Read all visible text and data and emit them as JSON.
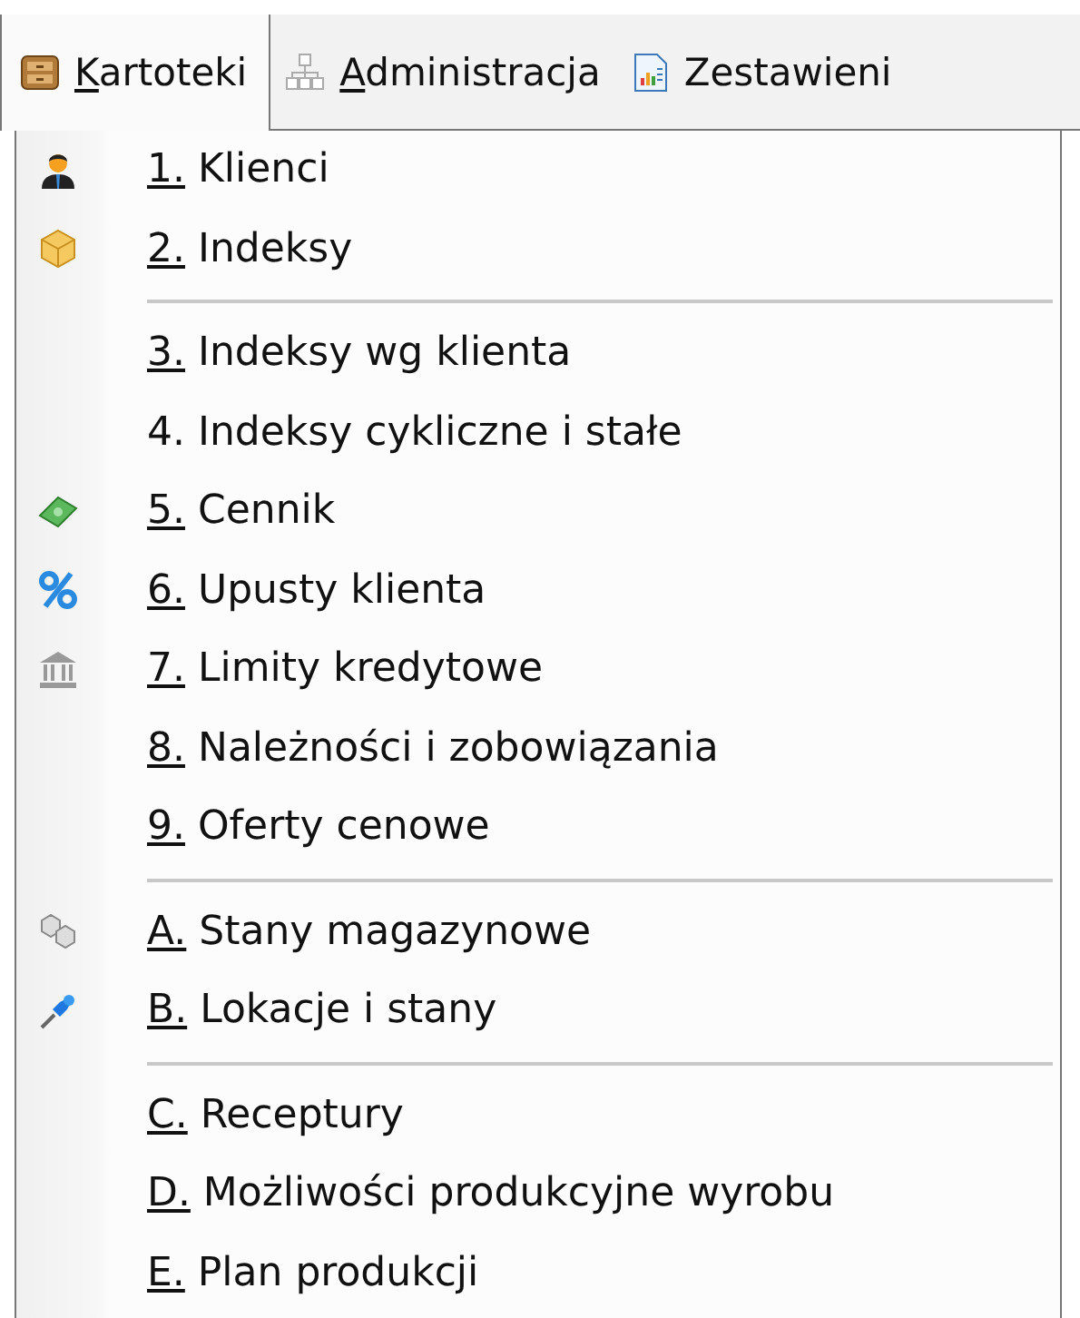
{
  "menu_bar": {
    "tabs": [
      {
        "label": "Kartoteki",
        "underlined_first": true,
        "selected": true,
        "kind": "cabinet"
      },
      {
        "label": "Administracja",
        "underlined_first": true,
        "selected": false,
        "kind": "hierarchy"
      },
      {
        "label": "Zestawieni",
        "underlined_first": false,
        "selected": false,
        "kind": "report"
      }
    ]
  },
  "dropdown": {
    "groups": [
      {
        "items": [
          {
            "label": "1. Klienci",
            "underlined_first": true,
            "kind": "person"
          },
          {
            "label": "2. Indeksy",
            "underlined_first": true,
            "kind": "package"
          }
        ]
      },
      {
        "items": [
          {
            "label": "3. Indeksy wg klienta",
            "underlined_first": true
          },
          {
            "label": "4. Indeksy cykliczne i stałe",
            "underlined_first": false
          },
          {
            "label": "5. Cennik",
            "underlined_first": true,
            "kind": "money"
          },
          {
            "label": "6. Upusty klienta",
            "underlined_first": true,
            "kind": "percent"
          },
          {
            "label": "7. Limity kredytowe",
            "underlined_first": true,
            "kind": "bank"
          },
          {
            "label": "8. Należności i zobowiązania",
            "underlined_first": true
          },
          {
            "label": "9. Oferty cenowe",
            "underlined_first": true
          }
        ]
      },
      {
        "items": [
          {
            "label": "A. Stany magazynowe",
            "underlined_first": true,
            "kind": "boxes"
          },
          {
            "label": "B. Lokacje i stany",
            "underlined_first": true,
            "kind": "pin"
          }
        ]
      },
      {
        "items": [
          {
            "label": "C. Receptury",
            "underlined_first": true
          },
          {
            "label": "D. Możliwości produkcyjne wyrobu",
            "underlined_first": true
          },
          {
            "label": "E. Plan produkcji",
            "underlined_first": true
          }
        ]
      }
    ]
  }
}
